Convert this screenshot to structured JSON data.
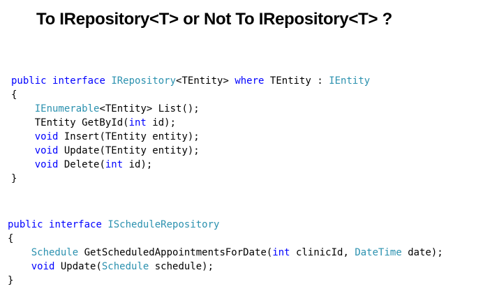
{
  "slide": {
    "title": "To IRepository<T> or Not To IRepository<T> ?"
  },
  "colors": {
    "keyword": "#0000ff",
    "type": "#2b91af",
    "text": "#000000",
    "background": "#ffffff"
  },
  "code_blocks": [
    {
      "lines": [
        [
          {
            "text": "public",
            "kind": "keyword"
          },
          {
            "text": " ",
            "kind": "plain"
          },
          {
            "text": "interface",
            "kind": "keyword"
          },
          {
            "text": " ",
            "kind": "plain"
          },
          {
            "text": "IRepository",
            "kind": "type"
          },
          {
            "text": "<TEntity> ",
            "kind": "plain"
          },
          {
            "text": "where",
            "kind": "keyword"
          },
          {
            "text": " TEntity : ",
            "kind": "plain"
          },
          {
            "text": "IEntity",
            "kind": "type"
          }
        ],
        [
          {
            "text": "{",
            "kind": "plain"
          }
        ],
        [
          {
            "text": "    ",
            "kind": "plain"
          },
          {
            "text": "IEnumerable",
            "kind": "type"
          },
          {
            "text": "<TEntity> List();",
            "kind": "plain"
          }
        ],
        [
          {
            "text": "    TEntity GetById(",
            "kind": "plain"
          },
          {
            "text": "int",
            "kind": "keyword"
          },
          {
            "text": " id);",
            "kind": "plain"
          }
        ],
        [
          {
            "text": "    ",
            "kind": "plain"
          },
          {
            "text": "void",
            "kind": "keyword"
          },
          {
            "text": " Insert(TEntity entity);",
            "kind": "plain"
          }
        ],
        [
          {
            "text": "    ",
            "kind": "plain"
          },
          {
            "text": "void",
            "kind": "keyword"
          },
          {
            "text": " Update(TEntity entity);",
            "kind": "plain"
          }
        ],
        [
          {
            "text": "    ",
            "kind": "plain"
          },
          {
            "text": "void",
            "kind": "keyword"
          },
          {
            "text": " Delete(",
            "kind": "plain"
          },
          {
            "text": "int",
            "kind": "keyword"
          },
          {
            "text": " id);",
            "kind": "plain"
          }
        ],
        [
          {
            "text": "}",
            "kind": "plain"
          }
        ]
      ]
    },
    {
      "lines": [
        [
          {
            "text": "public",
            "kind": "keyword"
          },
          {
            "text": " ",
            "kind": "plain"
          },
          {
            "text": "interface",
            "kind": "keyword"
          },
          {
            "text": " ",
            "kind": "plain"
          },
          {
            "text": "IScheduleRepository",
            "kind": "type"
          }
        ],
        [
          {
            "text": "{",
            "kind": "plain"
          }
        ],
        [
          {
            "text": "    ",
            "kind": "plain"
          },
          {
            "text": "Schedule",
            "kind": "type"
          },
          {
            "text": " GetScheduledAppointmentsForDate(",
            "kind": "plain"
          },
          {
            "text": "int",
            "kind": "keyword"
          },
          {
            "text": " clinicId, ",
            "kind": "plain"
          },
          {
            "text": "DateTime",
            "kind": "type"
          },
          {
            "text": " date);",
            "kind": "plain"
          }
        ],
        [
          {
            "text": "    ",
            "kind": "plain"
          },
          {
            "text": "void",
            "kind": "keyword"
          },
          {
            "text": " Update(",
            "kind": "plain"
          },
          {
            "text": "Schedule",
            "kind": "type"
          },
          {
            "text": " schedule);",
            "kind": "plain"
          }
        ],
        [
          {
            "text": "}",
            "kind": "plain"
          }
        ]
      ]
    }
  ]
}
